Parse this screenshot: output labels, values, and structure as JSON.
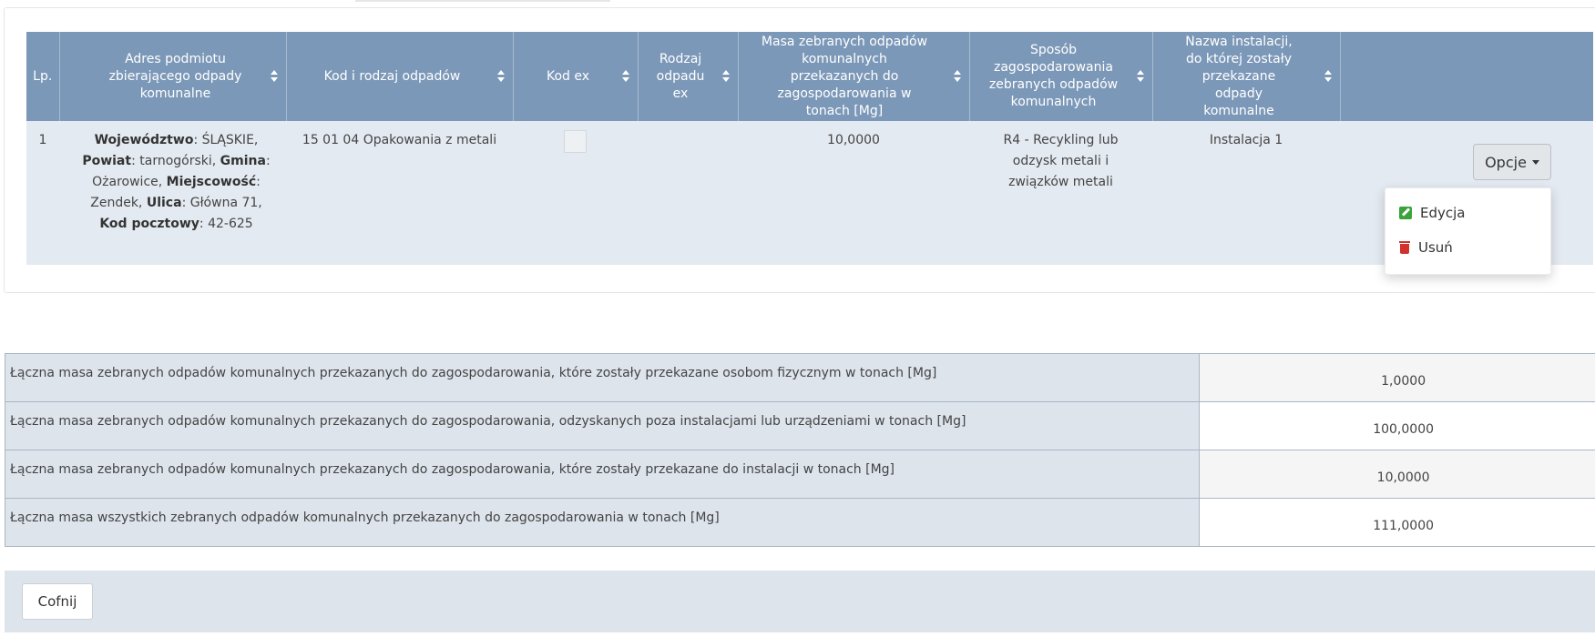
{
  "table": {
    "headers": {
      "lp": "Lp.",
      "adres": "Adres podmiotu zbierającego odpady komunalne",
      "kod": "Kod i rodzaj odpadów",
      "kod_ex": "Kod ex",
      "rodzaj_ex": "Rodzaj odpadu ex",
      "masa": "Masa zebranych odpadów komunalnych przekazanych do zagospodarowania w tonach [Mg]",
      "sposob": "Sposób zagospodarowania zebranych odpadów komunalnych",
      "nazwa": "Nazwa instalacji, do której zostały przekazane odpady komunalne"
    },
    "row": {
      "lp": "1",
      "woj_label": "Województwo",
      "woj": ": ŚLĄSKIE,",
      "pow_label": "Powiat",
      "pow": ": tarnogórski,",
      "gmina_label": "Gmina",
      "gmina": ": Ożarowice,",
      "miejsc_label": "Miejscowość",
      "miejsc": ": Zendek,",
      "ulica_label": "Ulica",
      "ulica": ": Główna 71,",
      "kod_label": "Kod pocztowy",
      "kod": ": 42-625",
      "kod_odpadu": "15 01 04 Opakowania z metali",
      "masa": "10,0000",
      "sposob": "R4 - Recykling lub odzysk metali i związków metali",
      "instalacja": "Instalacja 1"
    }
  },
  "options": {
    "button": "Opcje",
    "edit": "Edycja",
    "delete": "Usuń"
  },
  "summary": [
    {
      "label": "Łączna masa zebranych odpadów komunalnych przekazanych do zagospodarowania, które zostały przekazane osobom fizycznym w tonach [Mg]",
      "value": "1,0000"
    },
    {
      "label": "Łączna masa zebranych odpadów komunalnych przekazanych do zagospodarowania, odzyskanych poza instalacjami lub urządzeniami w tonach [Mg]",
      "value": "100,0000"
    },
    {
      "label": "Łączna masa zebranych odpadów komunalnych przekazanych do zagospodarowania, które zostały przekazane do instalacji w tonach [Mg]",
      "value": "10,0000"
    },
    {
      "label": "Łączna masa wszystkich zebranych odpadów komunalnych przekazanych do zagospodarowania w tonach [Mg]",
      "value": "111,0000"
    }
  ],
  "footer": {
    "back_button": "Cofnij"
  },
  "colors": {
    "header_bg": "#7c98b8",
    "row_bg": "#e4eaf1",
    "edit_icon": "#3aa33a",
    "delete_icon": "#d2322d"
  }
}
